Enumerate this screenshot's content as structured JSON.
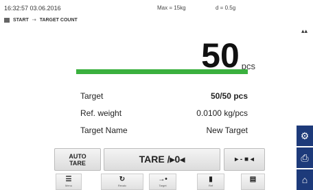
{
  "topbar": {
    "datetime": "16:32:57 03.06.2016",
    "max": "Max = 15kg",
    "d": "d = 0.5g"
  },
  "breadcrumb": {
    "start": "START",
    "current": "TARGET COUNT"
  },
  "display": {
    "value": "50",
    "unit": "pcs",
    "progress": 1.0,
    "progress_color": "#3ab03e"
  },
  "info": [
    {
      "label": "Target",
      "value": "50/50 pcs"
    },
    {
      "label": "Ref. weight",
      "value": "0.0100 kg/pcs"
    },
    {
      "label": "Target Name",
      "value": "New Target"
    }
  ],
  "buttons": {
    "auto_tare_line1": "AUTO",
    "auto_tare_line2": "TARE",
    "tare": "TARE /▸0◂",
    "ref": "▸ - ■ ◂"
  },
  "bottom_buttons": [
    {
      "icon": "menu-icon",
      "glyph": "☰",
      "label": "Menu"
    },
    {
      "icon": "recalc-icon",
      "glyph": "↻",
      "label": "Recalc"
    },
    {
      "icon": "target-icon",
      "glyph": "→•",
      "label": "Target"
    },
    {
      "icon": "ref-icon",
      "glyph": "▮",
      "label": "Ref"
    },
    {
      "icon": "delete-icon",
      "glyph": "▤",
      "label": ""
    }
  ],
  "side_buttons": [
    {
      "icon": "gear-icon",
      "glyph": "⚙"
    },
    {
      "icon": "print-icon",
      "glyph": "⎙"
    },
    {
      "icon": "home-icon",
      "glyph": "⌂"
    }
  ],
  "colors": {
    "accent": "#1d3a7a",
    "progress": "#3ab03e"
  }
}
